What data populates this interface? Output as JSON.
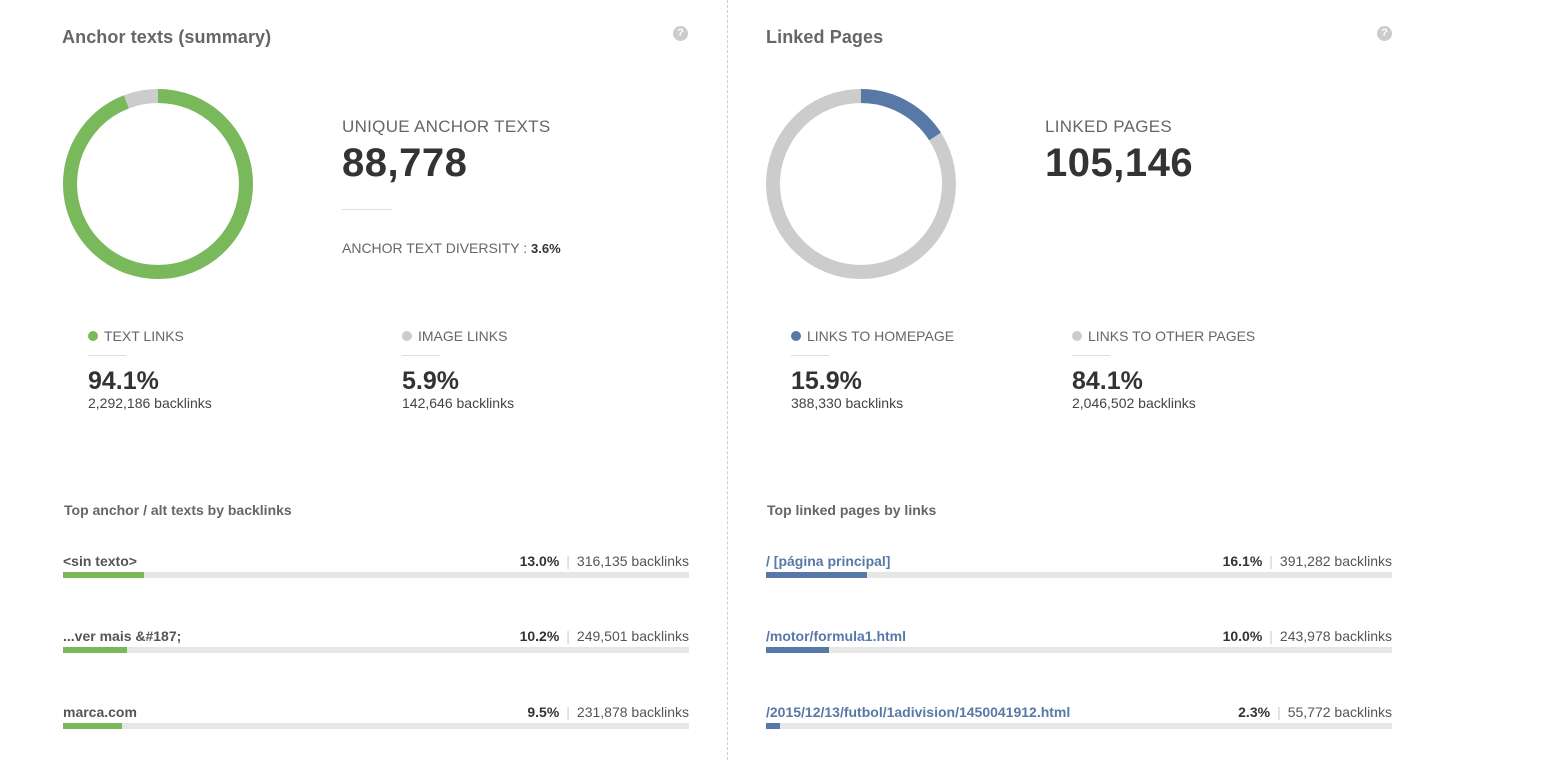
{
  "colors": {
    "green": "#7ab85c",
    "blue": "#5878a8",
    "gray": "#cccccc"
  },
  "anchor": {
    "title": "Anchor texts (summary)",
    "help_icon": "help-icon",
    "help_glyph": "?",
    "big_label": "UNIQUE ANCHOR TEXTS",
    "big_value": "88,778",
    "diversity_label": "ANCHOR TEXT DIVERSITY :",
    "diversity_value": "3.6%",
    "legend": [
      {
        "label": "TEXT LINKS",
        "pct": "94.1%",
        "sub": "2,292,186 backlinks",
        "color": "#7ab85c",
        "fraction": 0.941
      },
      {
        "label": "IMAGE LINKS",
        "pct": "5.9%",
        "sub": "142,646 backlinks",
        "color": "#cccccc",
        "fraction": 0.059
      }
    ],
    "section_title": "Top anchor / alt texts by backlinks",
    "rows": [
      {
        "label": "<sin texto>",
        "pct": "13.0%",
        "count": "316,135 backlinks",
        "fraction": 0.13
      },
      {
        "label": "...ver mais &#187;",
        "pct": "10.2%",
        "count": "249,501 backlinks",
        "fraction": 0.102
      },
      {
        "label": "marca.com",
        "pct": "9.5%",
        "count": "231,878 backlinks",
        "fraction": 0.095
      }
    ]
  },
  "linked": {
    "title": "Linked Pages",
    "help_icon": "help-icon",
    "help_glyph": "?",
    "big_label": "LINKED PAGES",
    "big_value": "105,146",
    "legend": [
      {
        "label": "LINKS TO HOMEPAGE",
        "pct": "15.9%",
        "sub": "388,330 backlinks",
        "color": "#5878a8",
        "fraction": 0.159
      },
      {
        "label": "LINKS TO OTHER PAGES",
        "pct": "84.1%",
        "sub": "2,046,502 backlinks",
        "color": "#cccccc",
        "fraction": 0.841
      }
    ],
    "section_title": "Top linked pages by links",
    "rows": [
      {
        "label": "/ [página principal]",
        "pct": "16.1%",
        "count": "391,282 backlinks",
        "fraction": 0.161
      },
      {
        "label": "/motor/formula1.html",
        "pct": "10.0%",
        "count": "243,978 backlinks",
        "fraction": 0.1
      },
      {
        "label": "/2015/12/13/futbol/1adivision/1450041912.html",
        "pct": "2.3%",
        "count": "55,772 backlinks",
        "fraction": 0.023
      }
    ]
  }
}
